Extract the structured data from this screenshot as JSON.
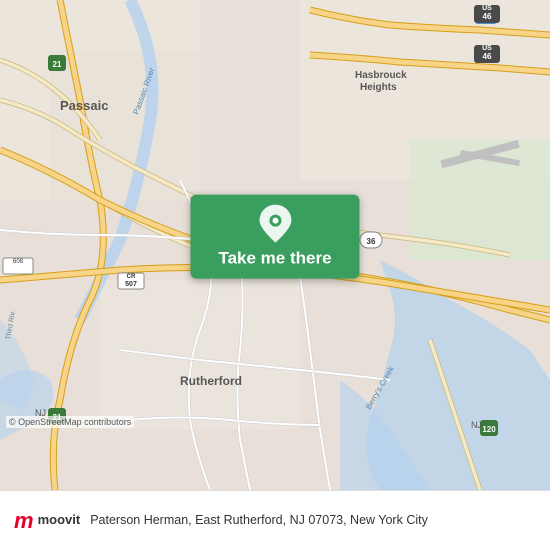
{
  "map": {
    "bg_color": "#e8e0d8",
    "center_lat": 40.82,
    "center_lon": -74.1
  },
  "button": {
    "label": "Take me there",
    "bg_color": "#3a9e5f"
  },
  "bottom_bar": {
    "address": "Paterson Herman, East Rutherford, NJ 07073, New York City",
    "osm_credit": "© OpenStreetMap contributors",
    "logo_m": "m",
    "logo_name": "moovit"
  }
}
